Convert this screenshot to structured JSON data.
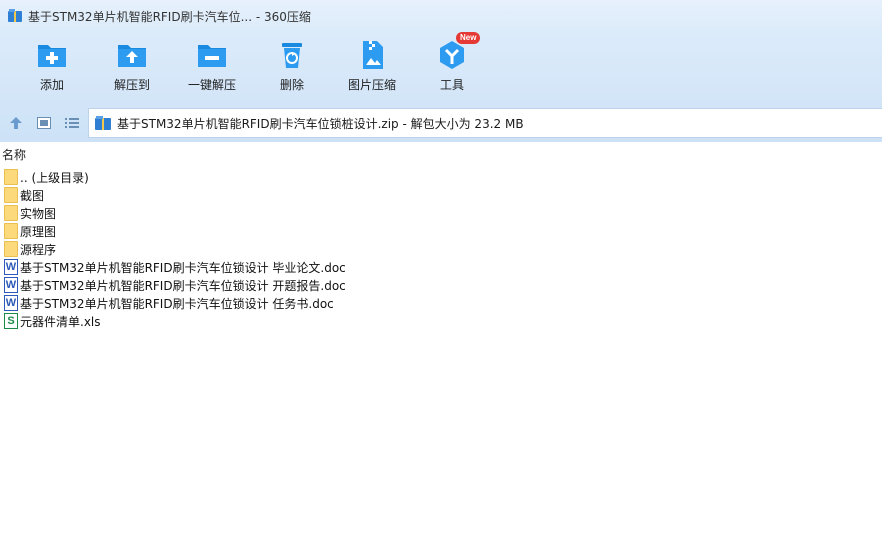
{
  "window": {
    "title": "基于STM32单片机智能RFID刷卡汽车位... - 360压缩"
  },
  "toolbar": {
    "buttons": [
      {
        "label": "添加",
        "icon": "add-folder-icon"
      },
      {
        "label": "解压到",
        "icon": "extract-to-icon"
      },
      {
        "label": "一键解压",
        "icon": "one-click-extract-icon"
      },
      {
        "label": "删除",
        "icon": "recycle-bin-icon"
      },
      {
        "label": "图片压缩",
        "icon": "image-compress-icon"
      },
      {
        "label": "工具",
        "icon": "tools-icon",
        "badge": "New"
      }
    ]
  },
  "address": {
    "path": "基于STM32单片机智能RFID刷卡汽车位锁桩设计.zip - 解包大小为 23.2 MB"
  },
  "list": {
    "header_name": "名称",
    "items": [
      {
        "name": ".. (上级目录)",
        "type": "folder"
      },
      {
        "name": "截图",
        "type": "folder"
      },
      {
        "name": "实物图",
        "type": "folder"
      },
      {
        "name": "原理图",
        "type": "folder"
      },
      {
        "name": "源程序",
        "type": "folder"
      },
      {
        "name": "基于STM32单片机智能RFID刷卡汽车位锁设计 毕业论文.doc",
        "type": "word",
        "glyph": "W"
      },
      {
        "name": "基于STM32单片机智能RFID刷卡汽车位锁设计 开题报告.doc",
        "type": "word",
        "glyph": "W"
      },
      {
        "name": "基于STM32单片机智能RFID刷卡汽车位锁设计 任务书.doc",
        "type": "word",
        "glyph": "W"
      },
      {
        "name": "元器件清单.xls",
        "type": "excel",
        "glyph": "S"
      }
    ]
  },
  "colors": {
    "accent_blue": "#1a8ae0",
    "badge_red": "#e53935",
    "folder_yellow": "#fcd97a"
  }
}
